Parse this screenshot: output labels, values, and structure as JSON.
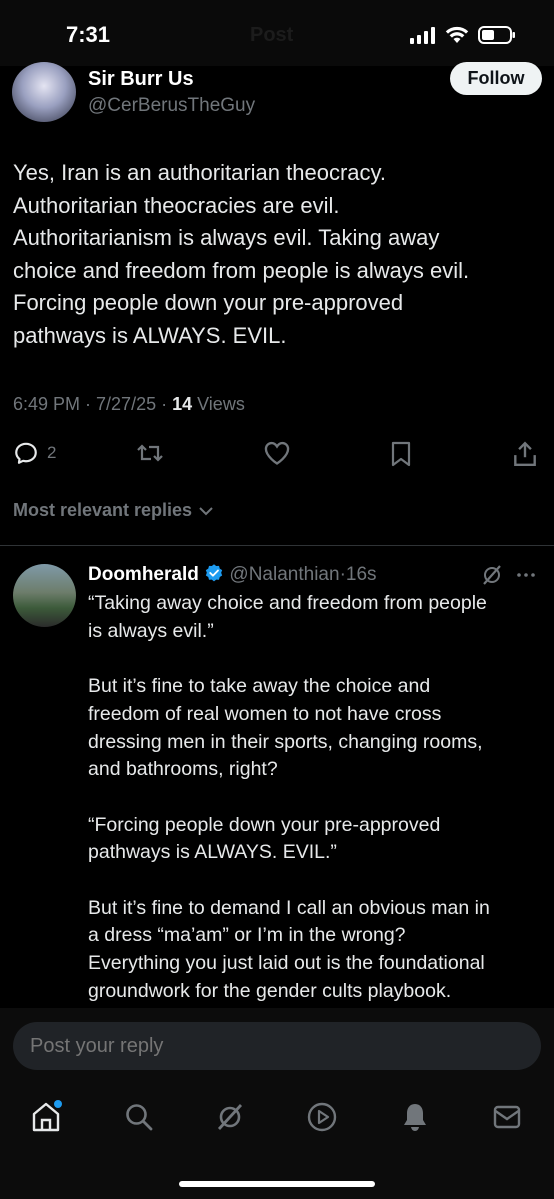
{
  "status_bar": {
    "time": "7:31",
    "ghost_title": "Post"
  },
  "post": {
    "author_name": "Sir Burr Us",
    "author_handle": "@CerBerusTheGuy",
    "follow_label": "Follow",
    "text": "Yes, Iran is an authoritarian theocracy.\nAuthoritarian theocracies are evil.\nAuthoritarianism is always evil. Taking away\nchoice and freedom from people is always evil.\nForcing people down your pre-approved\npathways is ALWAYS. EVIL.",
    "meta_prefix": "6:49 PM · 7/27/25 · ",
    "views_count": "14",
    "views_label": " Views",
    "reply_count": "2"
  },
  "replies_filter": {
    "label": "Most relevant replies"
  },
  "reply": {
    "author_name": "Doomherald",
    "author_handle": "@Nalanthian",
    "time": "·16s",
    "text": "“Taking away choice and freedom from people\nis always evil.”\n\nBut it’s fine to take away the choice and\nfreedom of real women to not have cross\ndressing men in their sports, changing rooms,\nand bathrooms, right?\n\n“Forcing people down your pre-approved\npathways is ALWAYS. EVIL.”\n\nBut it’s fine to demand I call an obvious man in\na dress “ma’am” or I’m in the wrong?\nEverything you just laid out is the foundational\ngroundwork for the gender cults playbook."
  },
  "composer": {
    "placeholder": "Post your reply"
  },
  "tabs": [
    "home-icon",
    "search-icon",
    "grok-icon",
    "video-icon",
    "notifications-icon",
    "messages-icon"
  ],
  "colors": {
    "background": "#000000",
    "text": "#e7e9ea",
    "muted": "#71767b",
    "verified": "#1d9bf0",
    "follow_bg": "#eff3f4",
    "divider": "#2f3336"
  }
}
